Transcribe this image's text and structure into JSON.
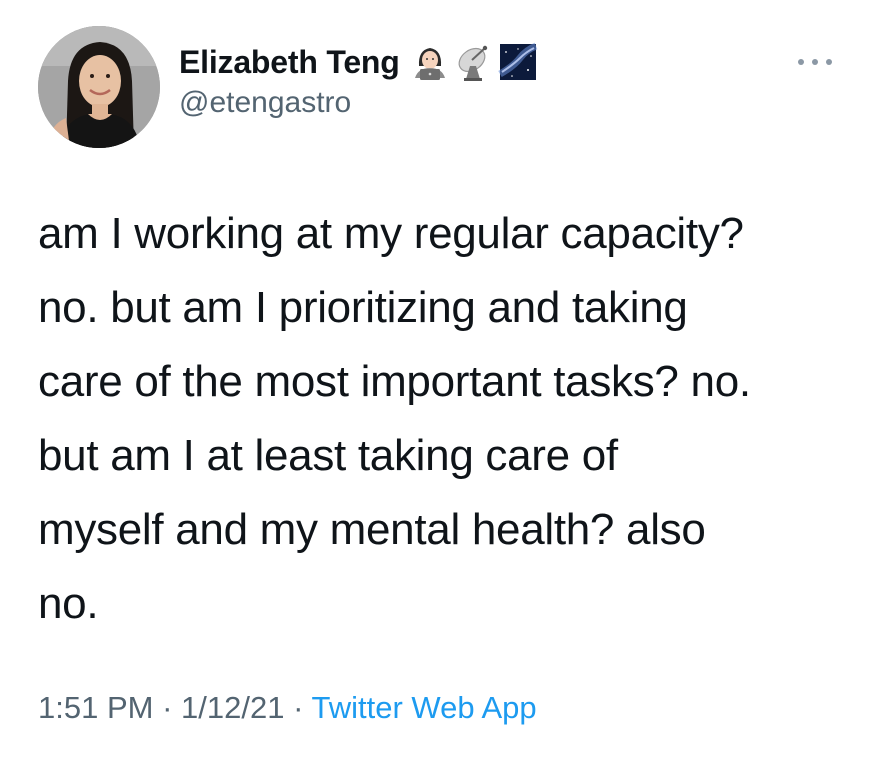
{
  "tweet": {
    "author": {
      "display_name": "Elizabeth Teng",
      "handle": "@etengastro",
      "name_emojis": [
        "woman-technologist-icon",
        "satellite-antenna-icon",
        "milky-way-icon"
      ]
    },
    "text": "am I working at my regular capacity?\nno. but am I prioritizing and taking\ncare of the most important tasks? no.\nbut am I at least taking care of\nmyself and my mental health? also\nno.",
    "time": "1:51 PM",
    "separator": "·",
    "date": "1/12/21",
    "source": "Twitter Web App",
    "colors": {
      "text": "#0f1419",
      "secondary": "#536471",
      "link": "#1d9bf0"
    }
  }
}
